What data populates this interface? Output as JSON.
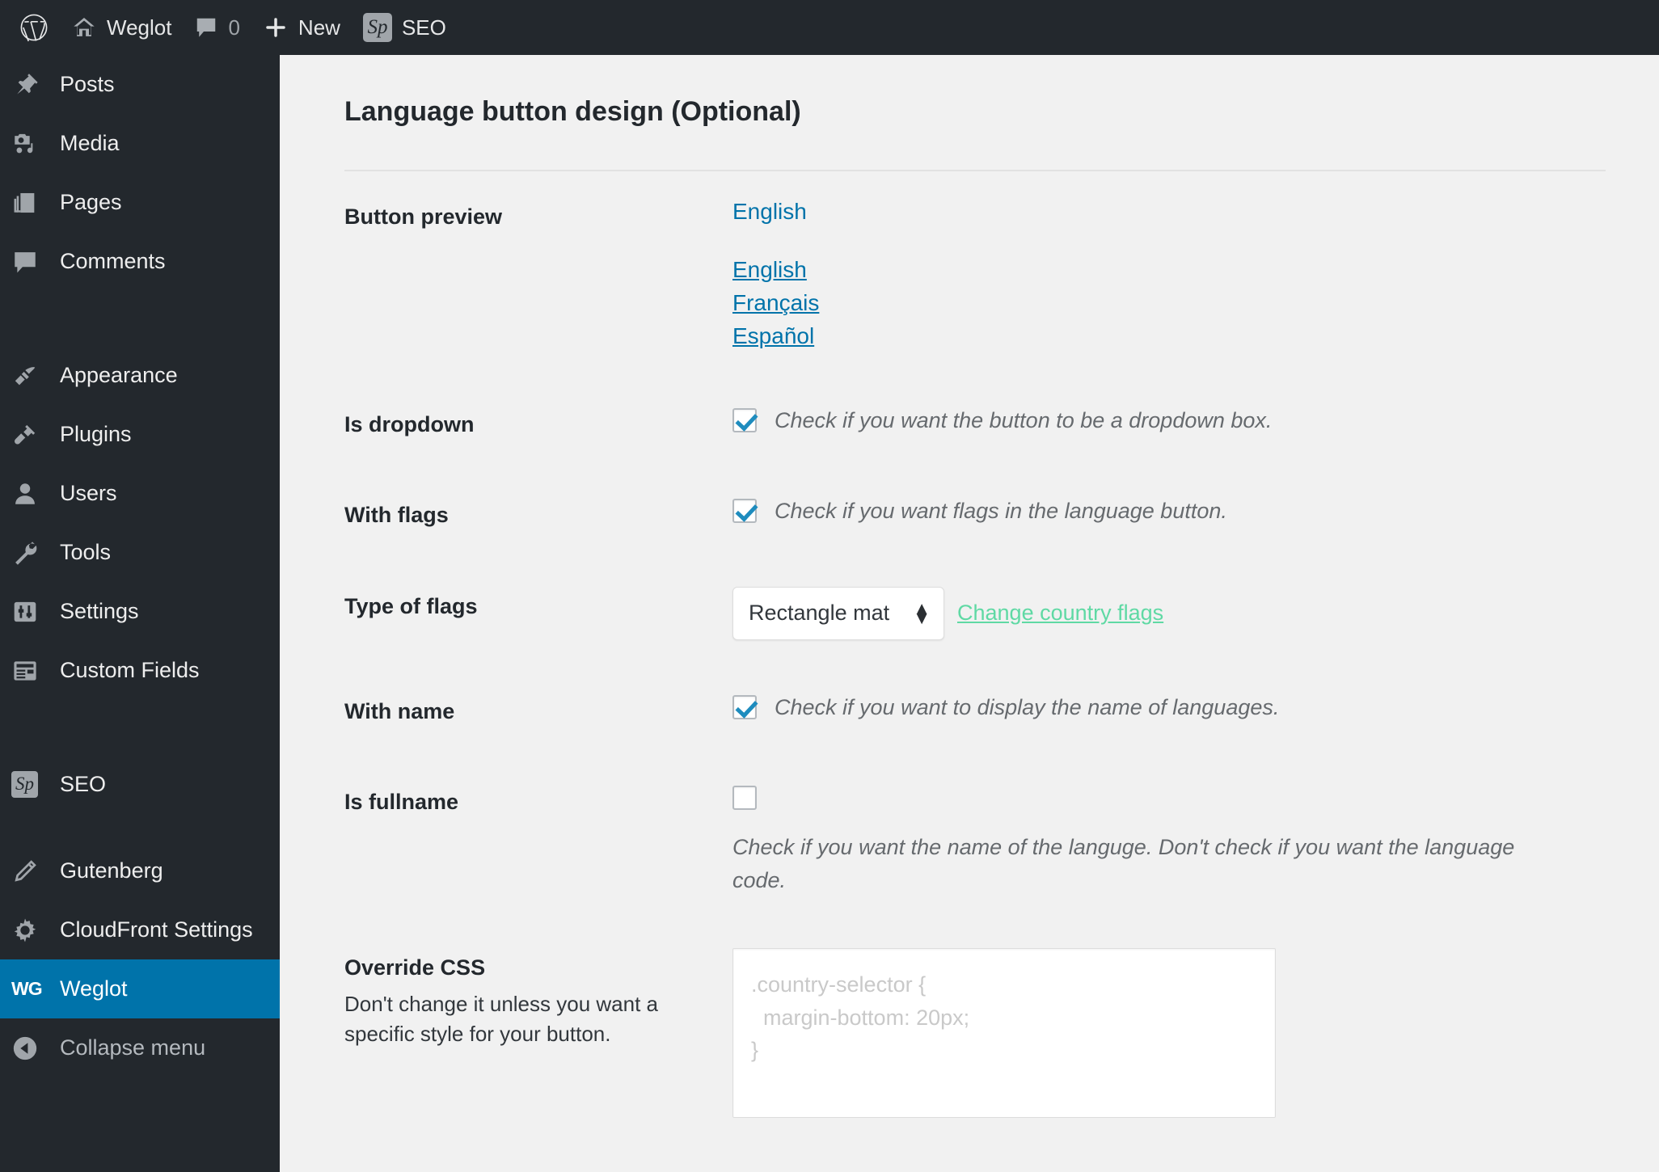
{
  "adminbar": {
    "wordpress_logo": "wordpress-logo",
    "site": {
      "icon": "home-icon",
      "label": "Weglot"
    },
    "comments": {
      "icon": "comment-icon",
      "count": "0"
    },
    "new": {
      "icon": "plus-icon",
      "label": "New"
    },
    "seo": {
      "icon": "sp-badge",
      "label": "SEO"
    }
  },
  "sidebar": {
    "items": [
      {
        "label": "Posts",
        "icon": "pin-icon",
        "current": false
      },
      {
        "label": "Media",
        "icon": "camera-icon",
        "current": false
      },
      {
        "label": "Pages",
        "icon": "pages-icon",
        "current": false
      },
      {
        "label": "Comments",
        "icon": "comment-icon",
        "current": false
      },
      {
        "label": "Appearance",
        "icon": "brush-icon",
        "current": false
      },
      {
        "label": "Plugins",
        "icon": "plug-icon",
        "current": false
      },
      {
        "label": "Users",
        "icon": "user-icon",
        "current": false
      },
      {
        "label": "Tools",
        "icon": "wrench-icon",
        "current": false
      },
      {
        "label": "Settings",
        "icon": "sliders-icon",
        "current": false
      },
      {
        "label": "Custom Fields",
        "icon": "table-icon",
        "current": false
      },
      {
        "label": "SEO",
        "icon": "sp-badge-icon",
        "current": false
      },
      {
        "label": "Gutenberg",
        "icon": "pencil-icon",
        "current": false
      },
      {
        "label": "CloudFront Settings",
        "icon": "gear-icon",
        "current": false
      },
      {
        "label": "Weglot",
        "icon": "weglot-logo-icon",
        "current": true
      }
    ],
    "collapse": {
      "label": "Collapse menu",
      "icon": "collapse-arrow-icon"
    }
  },
  "main": {
    "section_title": "Language button design (Optional)",
    "rows": {
      "button_preview": {
        "label": "Button preview",
        "selected_language": "English",
        "languages": [
          "English",
          "Français",
          "Español"
        ]
      },
      "is_dropdown": {
        "label": "Is dropdown",
        "checked": true,
        "description": "Check if you want the button to be a dropdown box."
      },
      "with_flags": {
        "label": "With flags",
        "checked": true,
        "description": "Check if you want flags in the language button."
      },
      "type_of_flags": {
        "label": "Type of flags",
        "selected": "Rectangle mat",
        "change_link": "Change country flags"
      },
      "with_name": {
        "label": "With name",
        "checked": true,
        "description": "Check if you want to display the name of languages."
      },
      "is_fullname": {
        "label": "Is fullname",
        "checked": false,
        "description": "Check if you want the name of the languge. Don't check if you want the language code."
      },
      "override_css": {
        "label": "Override CSS",
        "description": "Don't change it unless you want a specific style for your button.",
        "placeholder": ".country-selector {\n  margin-bottom: 20px;\n}"
      }
    }
  },
  "colors": {
    "admin_dark": "#23282d",
    "accent_blue": "#0073aa",
    "link_green": "#5fd9a4",
    "page_bg": "#f1f1f1"
  }
}
